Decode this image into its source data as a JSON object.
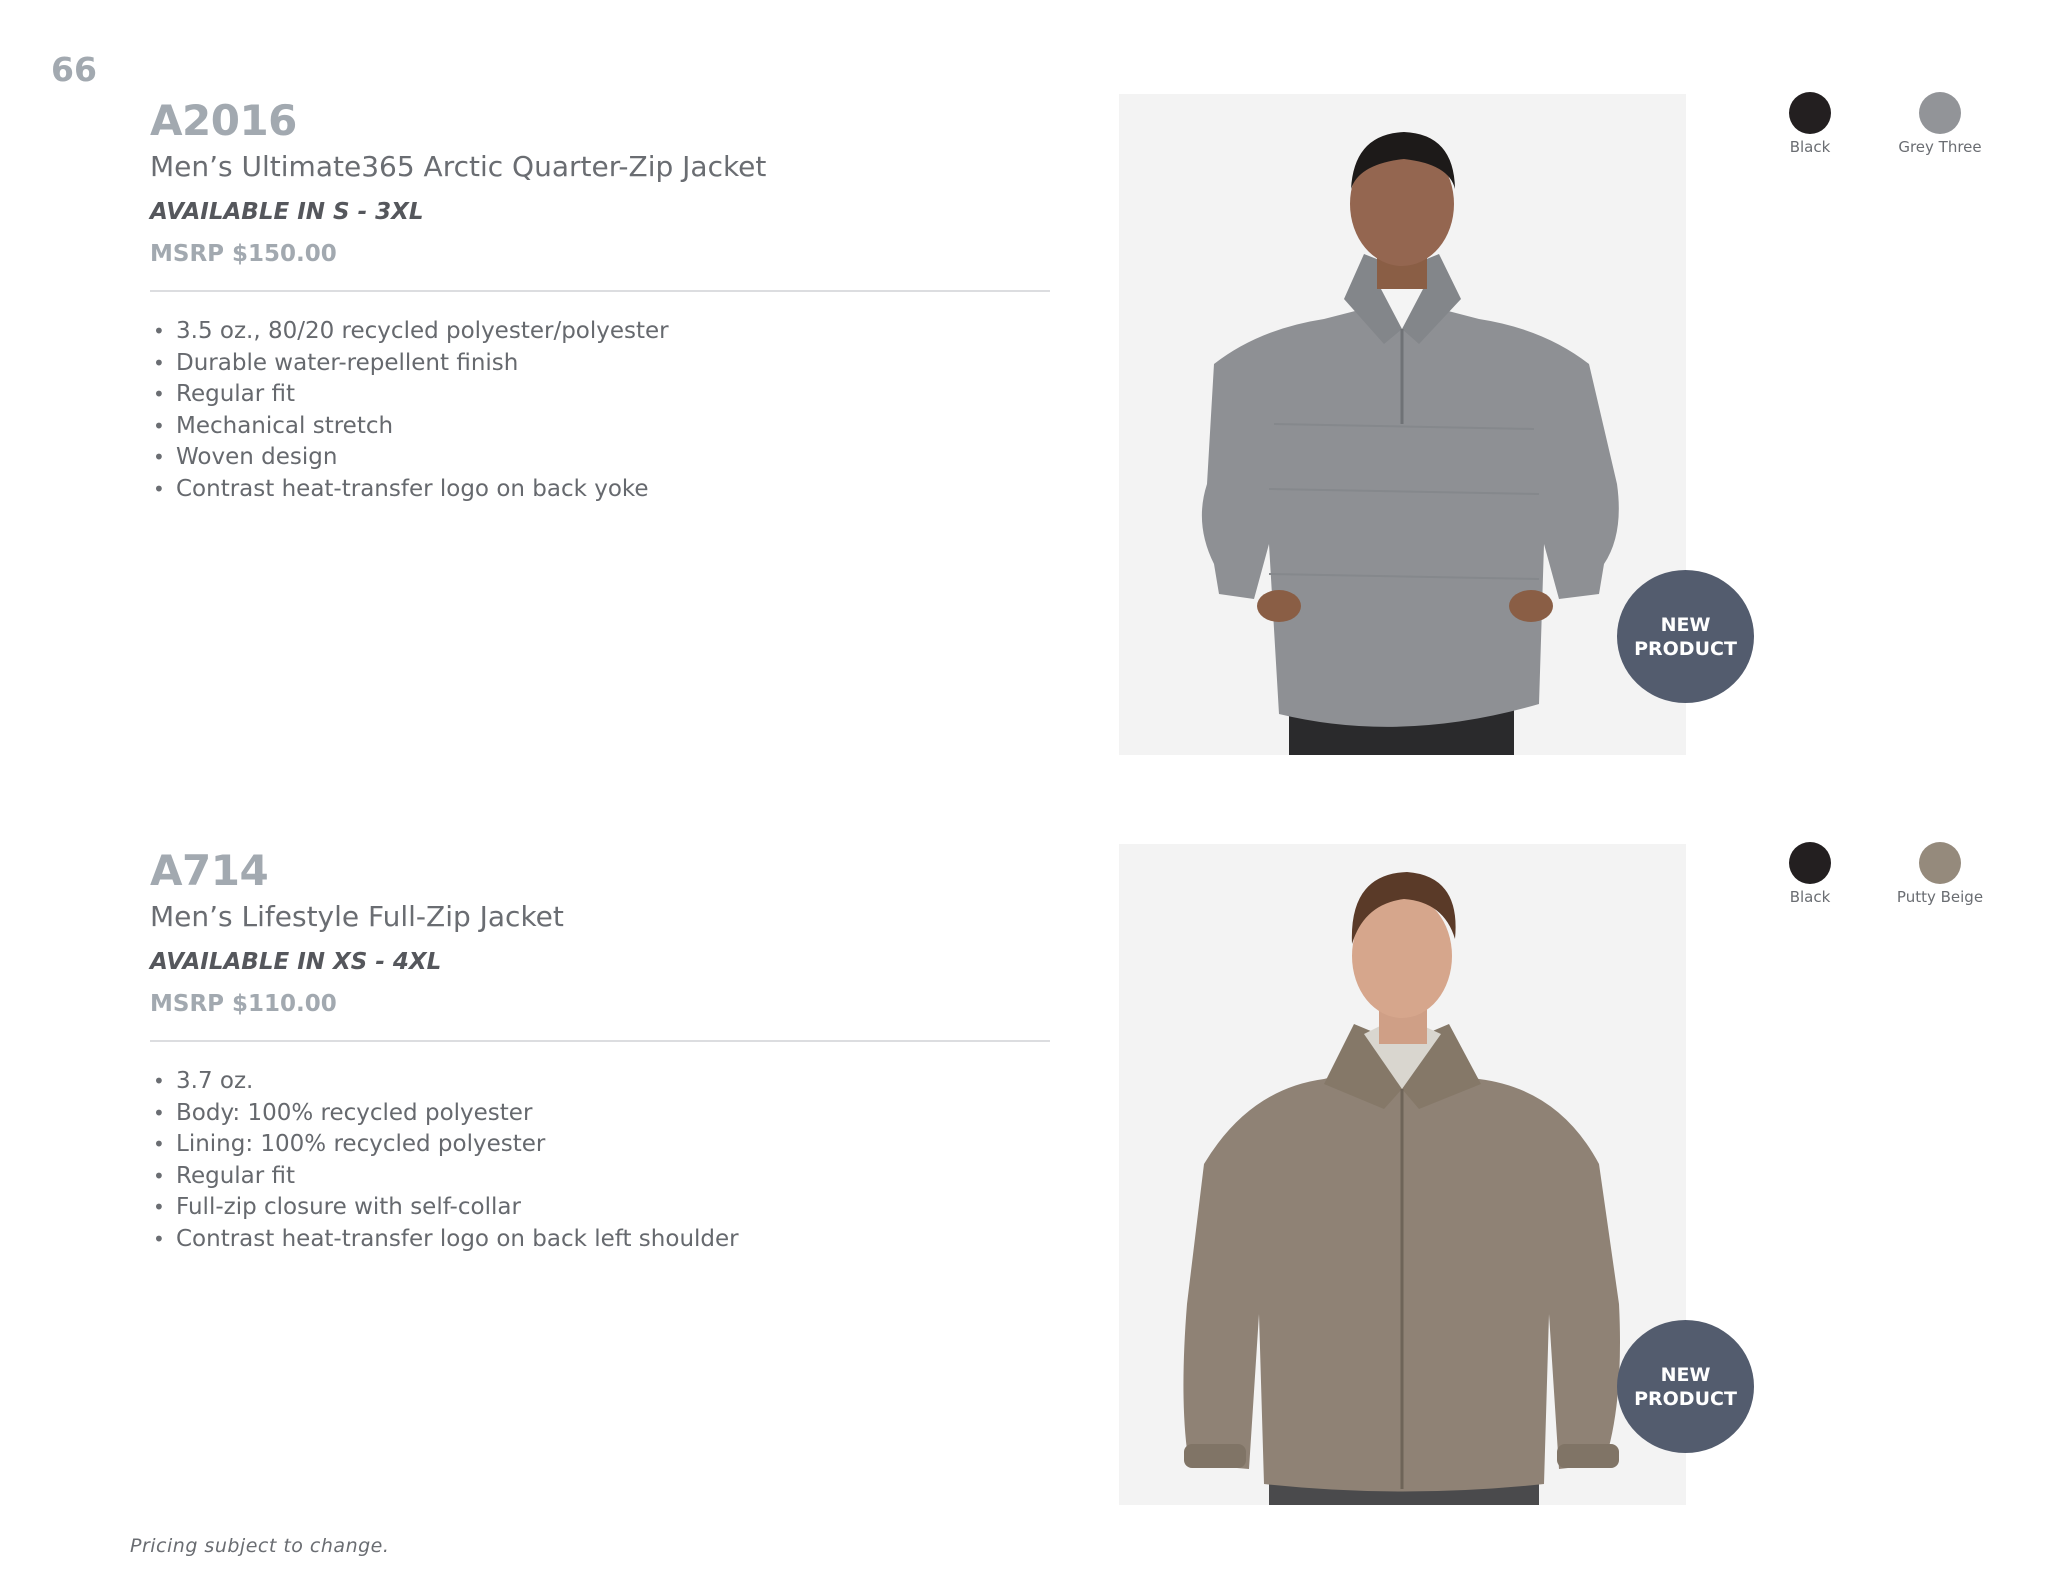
{
  "page_number": "66",
  "products": [
    {
      "sku": "A2016",
      "name": "Men’s Ultimate365 Arctic Quarter-Zip Jacket",
      "availability": "AVAILABLE IN S - 3XL",
      "price": "MSRP $150.00",
      "features": [
        "3.5 oz., 80/20 recycled polyester/polyester",
        "Durable water-repellent finish",
        "Regular fit",
        "Mechanical stretch",
        "Woven design",
        "Contrast heat-transfer logo on back yoke"
      ],
      "badge": {
        "line1": "NEW",
        "line2": "PRODUCT"
      },
      "colors": [
        {
          "label": "Black",
          "hex": "#231f20"
        },
        {
          "label": "Grey Three",
          "hex": "#929498"
        }
      ],
      "jacket_hex": "#8e9094"
    },
    {
      "sku": "A714",
      "name": "Men’s Lifestyle Full-Zip Jacket",
      "availability": "AVAILABLE IN XS - 4XL",
      "price": "MSRP $110.00",
      "features": [
        "3.7 oz.",
        "Body: 100% recycled polyester",
        "Lining: 100% recycled polyester",
        "Regular fit",
        "Full-zip closure with self-collar",
        "Contrast heat-transfer logo on back left shoulder"
      ],
      "badge": {
        "line1": "NEW",
        "line2": "PRODUCT"
      },
      "colors": [
        {
          "label": "Black",
          "hex": "#231f20"
        },
        {
          "label": "Putty Beige",
          "hex": "#958a7c"
        }
      ],
      "jacket_hex": "#8f8275"
    }
  ],
  "footer_note": "Pricing subject to change."
}
